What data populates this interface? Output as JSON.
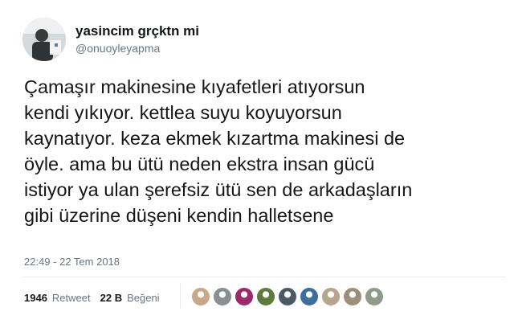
{
  "user": {
    "display_name": "yasincim grçktn mi",
    "handle": "@onuoyleyapma"
  },
  "tweet": {
    "lines": [
      "Çamaşır makinesine kıyafetleri atıyorsun",
      "kendi yıkıyor. kettlea suyu koyuyorsun",
      "kaynatıyor. keza ekmek kızartma makinesi de",
      "öyle. ama bu ütü neden ekstra insan gücü",
      "istiyor ya ulan şerefsiz ütü sen de arkadaşların",
      "gibi üzerine düşeni kendin halletsene"
    ],
    "timestamp": "22:49 - 22 Tem 2018"
  },
  "stats": {
    "retweet_count": "1946",
    "retweet_label": "Retweet",
    "like_count": "22 B",
    "like_label": "Beğeni"
  },
  "likers": [
    {
      "name": "liker-avatar-1",
      "color": "#c9a88a"
    },
    {
      "name": "liker-avatar-2",
      "color": "#8a8f93"
    },
    {
      "name": "liker-avatar-3",
      "color": "#9b2a6a"
    },
    {
      "name": "liker-avatar-4",
      "color": "#5f7a3d"
    },
    {
      "name": "liker-avatar-5",
      "color": "#4c5a66"
    },
    {
      "name": "liker-avatar-6",
      "color": "#3d6e9c"
    },
    {
      "name": "liker-avatar-7",
      "color": "#b7a48c"
    },
    {
      "name": "liker-avatar-8",
      "color": "#9c8f7a"
    },
    {
      "name": "liker-avatar-9",
      "color": "#8f9a8a"
    }
  ]
}
